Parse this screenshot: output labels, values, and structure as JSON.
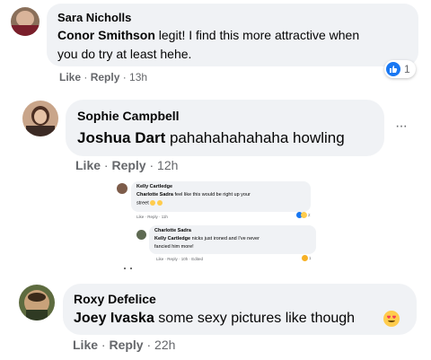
{
  "comments": [
    {
      "author": "Sara Nicholls",
      "mention": "Conor Smithson",
      "text_line1": " legit! I find this more attractive when",
      "text_line2": "you do try at least hehe.",
      "like": "Like",
      "reply": "Reply",
      "time": "13h",
      "reaction_count": "1"
    },
    {
      "author": "Sophie Campbell",
      "mention": "Joshua Dart",
      "text": " pahahahahahaha howling",
      "like": "Like",
      "reply": "Reply",
      "time": "12h",
      "more": "···"
    },
    {
      "author": "Roxy Defelice",
      "mention": "Joey Ivaska",
      "text": " some sexy pictures like though",
      "like": "Like",
      "reply": "Reply",
      "time": "22h"
    }
  ],
  "embedded": {
    "c1": {
      "author": "Kelly Cartledge",
      "mention": "Charlotte Sadra",
      "text_line1": " feel like this would be right up your",
      "text_line2": "street",
      "meta": "Like · Reply · 11h",
      "reaction_count": "2"
    },
    "c2": {
      "author": "Charlotte Sadra",
      "mention": "Kelly Cartledge",
      "text_line1": " nicks just ironed and I've never",
      "text_line2": "fancied him more!",
      "meta": "Like · Reply · 10h · Edited",
      "reaction_count": "1"
    }
  },
  "colors": {
    "bubble": "#f0f2f5",
    "meta": "#65676b",
    "like_blue": "#1877f2",
    "heart_red": "#f33e58"
  },
  "icons": [
    "like-reaction-icon",
    "heart-eyes-emoji-icon",
    "laughing-emoji-icon",
    "more-options-icon"
  ]
}
